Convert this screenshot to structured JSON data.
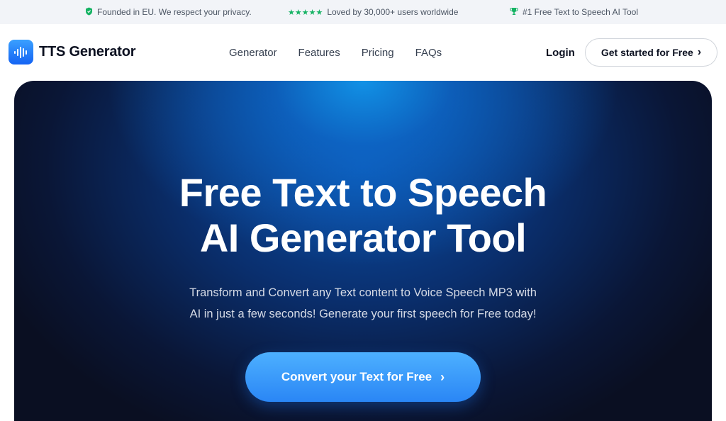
{
  "topbar": {
    "privacy_text": "Founded in EU. We respect your privacy.",
    "stars": "★★★★★",
    "loved_text": "Loved by 30,000+ users worldwide",
    "rank_text": "#1 Free Text to Speech AI Tool"
  },
  "nav": {
    "brand": "TTS Generator",
    "links": [
      "Generator",
      "Features",
      "Pricing",
      "FAQs"
    ],
    "login": "Login",
    "cta": "Get started for Free",
    "cta_chevron": "›"
  },
  "hero": {
    "title_line1": "Free Text to Speech",
    "title_line2": "AI Generator Tool",
    "subtitle_line1": "Transform and Convert any Text content to Voice Speech MP3 with",
    "subtitle_line2": "AI in just a few seconds! Generate your first speech for Free today!",
    "button": "Convert your Text for Free",
    "button_chevron": "›"
  },
  "colors": {
    "accent": "#2a86f5",
    "star_green": "#16b364",
    "hero_dark": "#0a0f22"
  },
  "icons": [
    "shield-icon",
    "star-icon",
    "trophy-icon",
    "sound-wave-logo-icon",
    "chevron-right-icon"
  ]
}
